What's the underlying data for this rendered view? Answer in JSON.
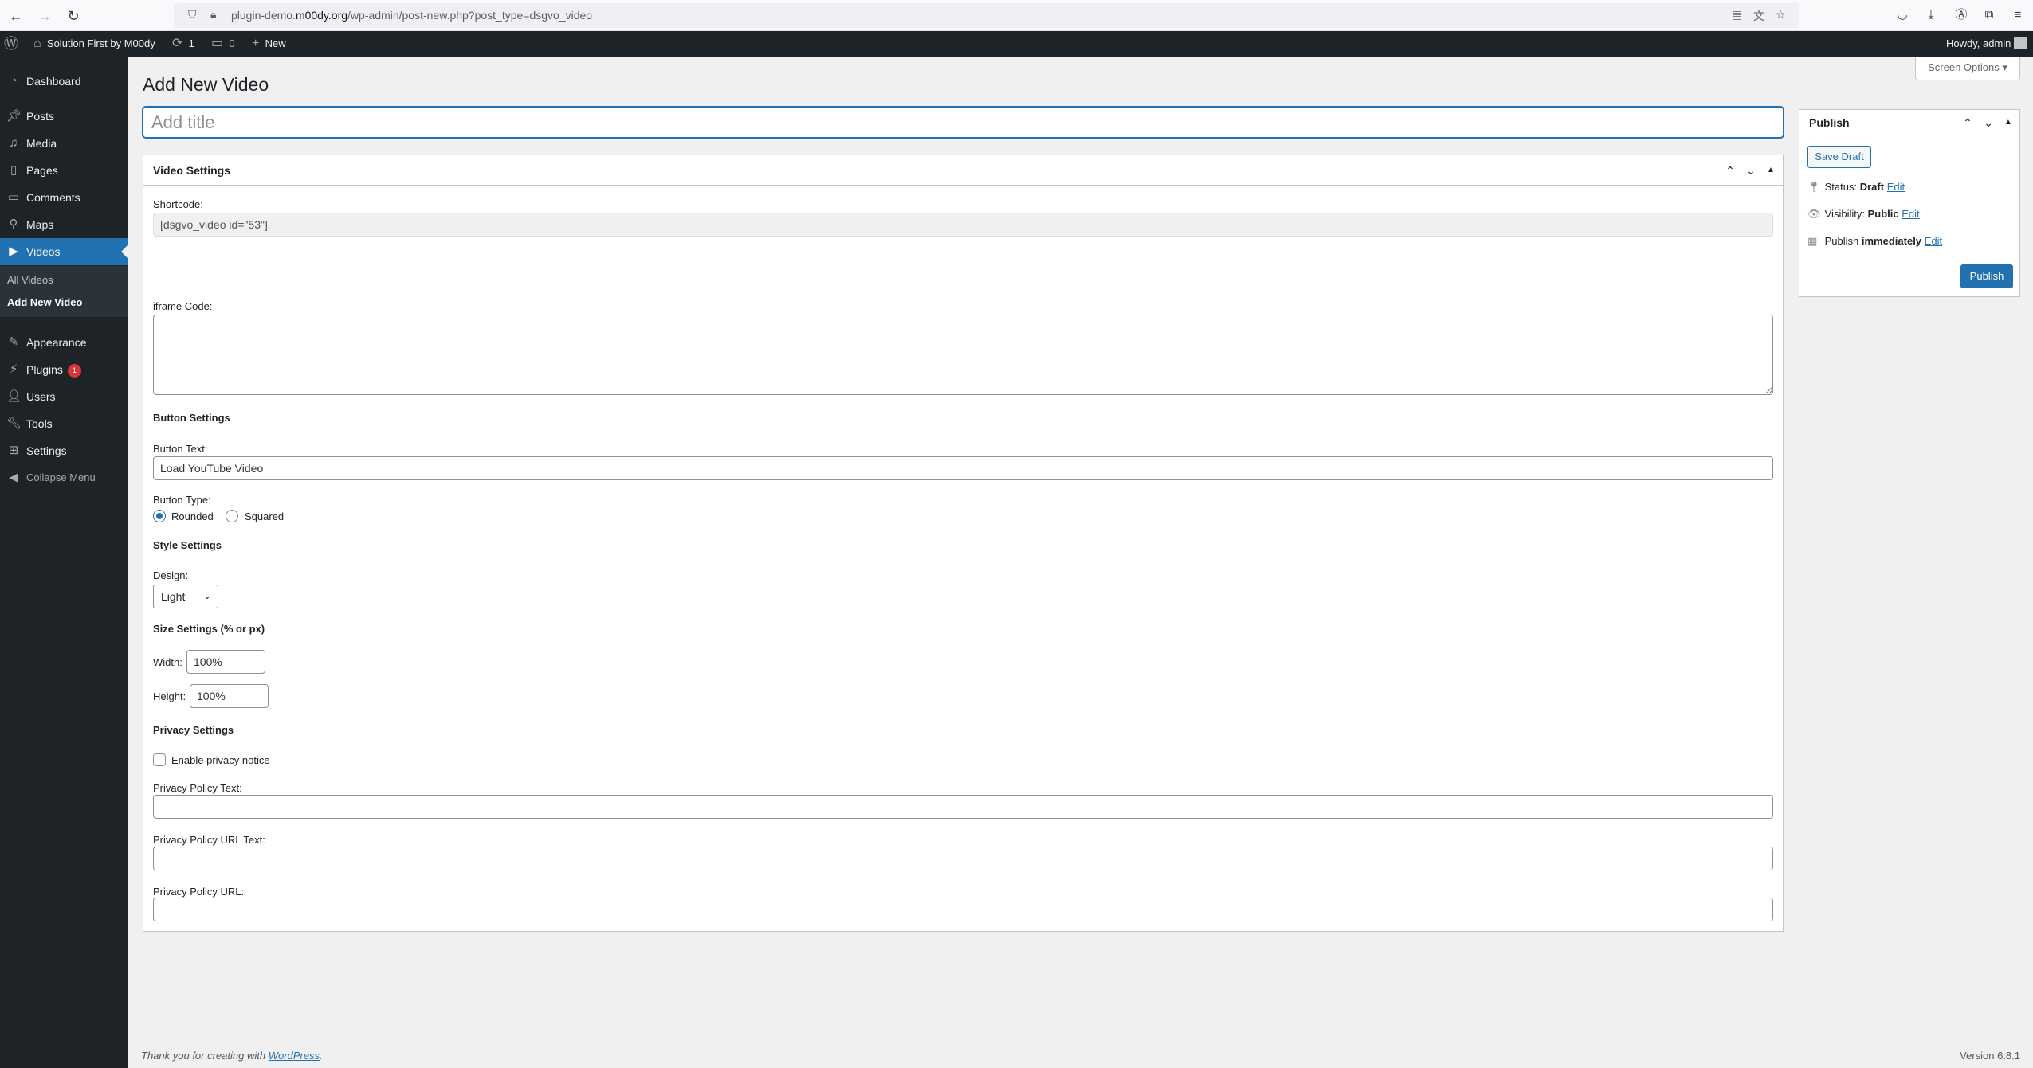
{
  "browser": {
    "url_prefix": "plugin-demo.",
    "url_domain": "m00dy.org",
    "url_path": "/wp-admin/post-new.php?post_type=dsgvo_video"
  },
  "adminbar": {
    "site_name": "Solution First by M00dy",
    "updates_count": "1",
    "comments_count": "0",
    "new_label": "New",
    "howdy": "Howdy, admin"
  },
  "sidebar": {
    "items": [
      {
        "label": "Dashboard",
        "icon": "dashboard-icon"
      },
      {
        "label": "Posts",
        "icon": "pin-icon"
      },
      {
        "label": "Media",
        "icon": "media-icon"
      },
      {
        "label": "Pages",
        "icon": "page-icon"
      },
      {
        "label": "Comments",
        "icon": "comment-icon"
      },
      {
        "label": "Maps",
        "icon": "map-icon"
      },
      {
        "label": "Videos",
        "icon": "video-icon"
      },
      {
        "label": "Appearance",
        "icon": "brush-icon"
      },
      {
        "label": "Plugins",
        "icon": "plugin-icon",
        "badge": "1"
      },
      {
        "label": "Users",
        "icon": "user-icon"
      },
      {
        "label": "Tools",
        "icon": "wrench-icon"
      },
      {
        "label": "Settings",
        "icon": "settings-icon"
      },
      {
        "label": "Collapse Menu",
        "icon": "collapse-icon"
      }
    ],
    "submenu": [
      "All Videos",
      "Add New Video"
    ]
  },
  "page": {
    "title": "Add New Video",
    "screen_options": "Screen Options",
    "title_placeholder": "Add title"
  },
  "video_settings": {
    "box_title": "Video Settings",
    "shortcode_label": "Shortcode:",
    "shortcode_value": "[dsgvo_video id=\"53\"]",
    "iframe_label": "iframe Code:",
    "button_settings_heading": "Button Settings",
    "button_text_label": "Button Text:",
    "button_text_value": "Load YouTube Video",
    "button_type_label": "Button Type:",
    "button_type_rounded": "Rounded",
    "button_type_squared": "Squared",
    "style_settings_heading": "Style Settings",
    "design_label": "Design:",
    "design_value": "Light",
    "size_settings_heading": "Size Settings (% or px)",
    "width_label": "Width:",
    "width_value": "100%",
    "height_label": "Height:",
    "height_value": "100%",
    "privacy_settings_heading": "Privacy Settings",
    "enable_privacy_label": "Enable privacy notice",
    "privacy_text_label": "Privacy Policy Text:",
    "privacy_url_text_label": "Privacy Policy URL Text:",
    "privacy_url_label": "Privacy Policy URL:"
  },
  "publish": {
    "title": "Publish",
    "save_draft": "Save Draft",
    "status_label": "Status:",
    "status_value": "Draft",
    "visibility_label": "Visibility:",
    "visibility_value": "Public",
    "publish_label": "Publish",
    "publish_value": "immediately",
    "edit": "Edit",
    "publish_button": "Publish"
  },
  "footer": {
    "thanks": "Thank you for creating with",
    "wordpress": "WordPress",
    "version": "Version 6.8.1"
  }
}
